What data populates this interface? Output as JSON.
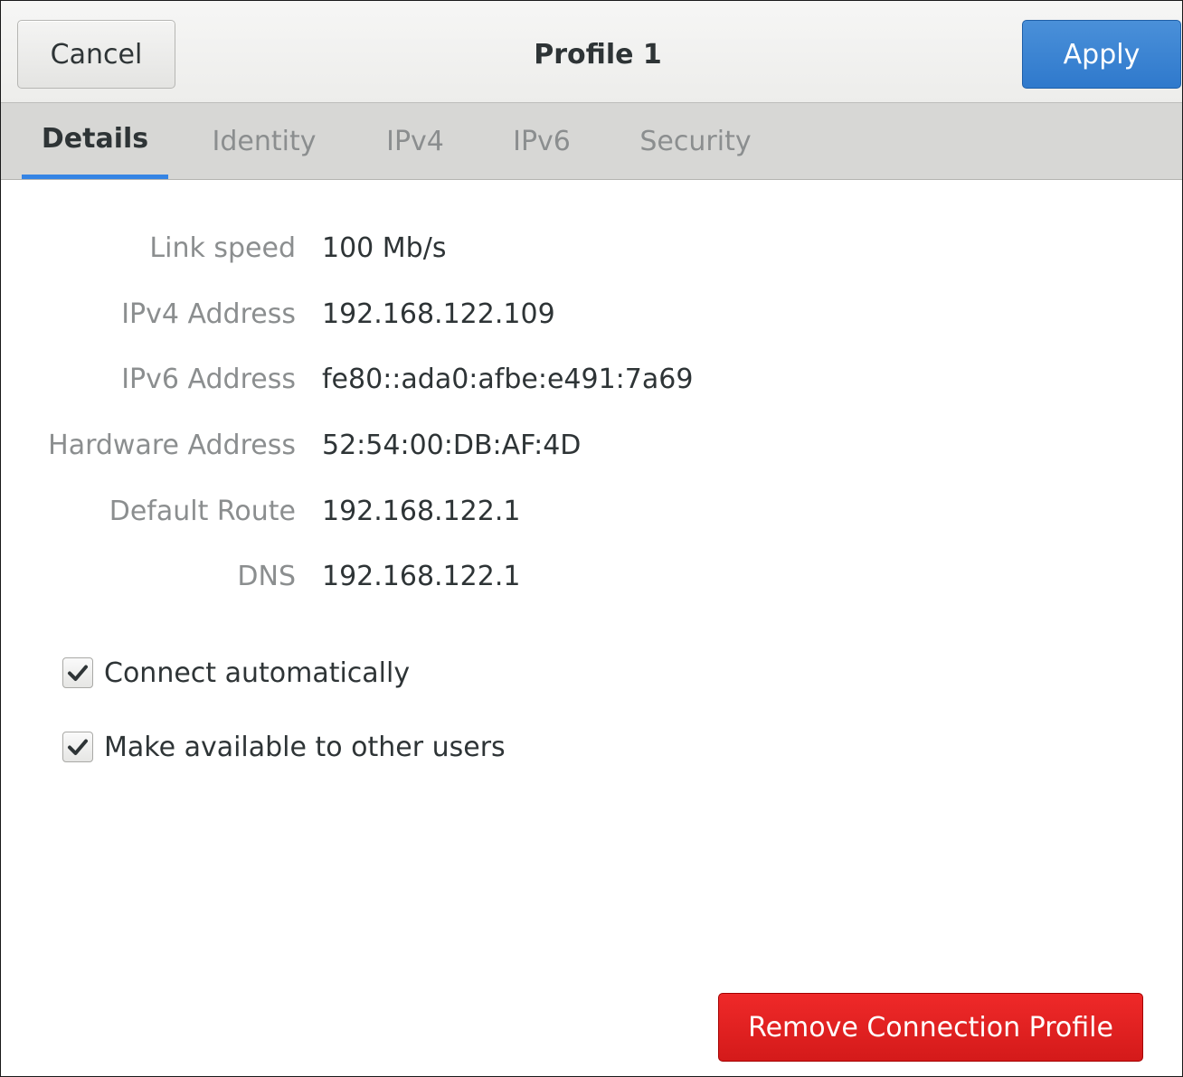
{
  "header": {
    "cancel_label": "Cancel",
    "title": "Profile 1",
    "apply_label": "Apply"
  },
  "tabs": [
    {
      "label": "Details",
      "active": true
    },
    {
      "label": "Identity",
      "active": false
    },
    {
      "label": "IPv4",
      "active": false
    },
    {
      "label": "IPv6",
      "active": false
    },
    {
      "label": "Security",
      "active": false
    }
  ],
  "details": [
    {
      "label": "Link speed",
      "value": "100 Mb/s"
    },
    {
      "label": "IPv4 Address",
      "value": "192.168.122.109"
    },
    {
      "label": "IPv6 Address",
      "value": "fe80::ada0:afbe:e491:7a69"
    },
    {
      "label": "Hardware Address",
      "value": "52:54:00:DB:AF:4D"
    },
    {
      "label": "Default Route",
      "value": "192.168.122.1"
    },
    {
      "label": "DNS",
      "value": "192.168.122.1"
    }
  ],
  "options": [
    {
      "label": "Connect automatically",
      "checked": true
    },
    {
      "label": "Make available to other users",
      "checked": true
    }
  ],
  "remove_label": "Remove Connection Profile",
  "colors": {
    "accent": "#3584e4",
    "apply": "#2f79cc",
    "destructive": "#e01b1b"
  },
  "icons": {
    "checkmark": "checkmark-icon"
  }
}
